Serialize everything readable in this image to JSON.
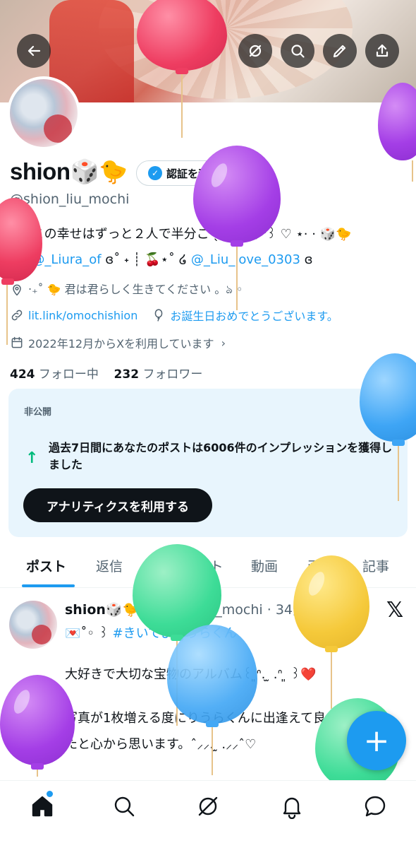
{
  "header": {
    "back_icon": "arrow-left-icon",
    "grok_icon": "grok-icon",
    "search_icon": "search-icon",
    "edit_icon": "pencil-icon",
    "share_icon": "share-icon"
  },
  "profile": {
    "display_name": "shion🎲🐤",
    "verify_label": "認証を受ける",
    "handle": "@shion_liu_mochi",
    "bio_line1": "꒰ঌ この幸せはずっと２人で半分こ ˎˊ˗ ꒰ᐢ⸝⸝ᐢ꒱ ♡ ⋆·  ·  🎲🐤",
    "bio_line2_prefix": "໒꒱ ",
    "bio_mention1": "@_Liura_of",
    "bio_line2_mid": " ɞ˚ ˖ ┊ 🍒⋆˚ ໒ ",
    "bio_mention2": "@_Liu_love_0303",
    "bio_line2_suffix": " ɞ",
    "location": "‧₊˚ 🐤 君は君らしく生きてください 。ঌ ◦",
    "website": "lit.link/omochishion",
    "birthday": "お誕生日おめでとうございます。",
    "joined": "2022年12月からXを利用しています",
    "following_count": "424",
    "following_label": "フォロー中",
    "followers_count": "232",
    "followers_label": "フォロワー"
  },
  "analytics_card": {
    "label": "非公開",
    "close": "✕",
    "message": "過去7日間にあなたのポストは6006件のインプレッションを獲得しました",
    "cta": "アナリティクスを利用する"
  },
  "tabs": [
    "ポスト",
    "返信",
    "ハイライト",
    "動画",
    "画像",
    "記事"
  ],
  "post": {
    "name": "shion🎲🐤",
    "handle": "@shion_liu_mochi",
    "time": "· 34分",
    "line1_prefix": "💌˚◦ ꒱ ",
    "hashtag": "#きいてよりうらくん",
    "line2": "大好きで大切な宝物のアルバム꒰ ͈ᐢ. ̫ .ᐢ ͈ ꒱❤️",
    "line3": "写真が1枚増える度にりうらくんに出逢えて良かっ",
    "line4": "たと心から思います。ˆ⸝⸝. ̫ .⸝⸝ˆ♡"
  },
  "fab_label": "+",
  "nav": {
    "home_icon": "home-icon",
    "search_icon": "search-icon",
    "grok_icon": "grok-icon",
    "notifications_icon": "bell-icon",
    "messages_icon": "message-icon"
  },
  "colors": {
    "accent": "#1d9bf0",
    "card_bg": "#e8f5fd",
    "text": "#0f1419",
    "secondary": "#536471"
  }
}
